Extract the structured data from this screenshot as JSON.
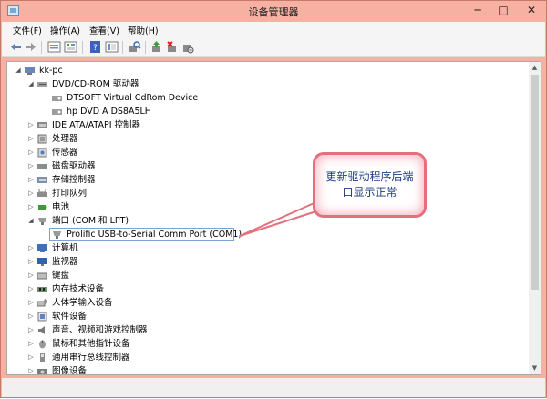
{
  "window": {
    "title": "设备管理器",
    "controls": {
      "minimize": "─",
      "maximize": "□",
      "close": "✕"
    }
  },
  "menu": [
    "文件(F)",
    "操作(A)",
    "查看(V)",
    "帮助(H)"
  ],
  "tree": {
    "root": "kk-pc",
    "dvd": "DVD/CD-ROM 驱动器",
    "dvd_children": [
      "DTSOFT Virtual CdRom Device",
      "hp DVD A  DS8A5LH"
    ],
    "ide": "IDE ATA/ATAPI 控制器",
    "processor": "处理器",
    "sensor": "传感器",
    "disk": "磁盘驱动器",
    "storage": "存储控制器",
    "printq": "打印队列",
    "battery": "电池",
    "ports": "端口 (COM 和 LPT)",
    "port_child": "Prolific USB-to-Serial Comm Port (COM1)",
    "computer": "计算机",
    "monitor": "监视器",
    "keyboard": "键盘",
    "memtech": "内存技术设备",
    "hid": "人体学输入设备",
    "software": "软件设备",
    "sound": "声音、视频和游戏控制器",
    "mouse": "鼠标和其他指针设备",
    "usb": "通用串行总线控制器",
    "imaging": "图像设备"
  },
  "callout": {
    "line1": "更新驱动程序后端",
    "line2": "口显示正常"
  },
  "colors": {
    "title_bar": "#f7b1a3",
    "callout_border": "#e3707c",
    "callout_text": "#1f3b80"
  }
}
